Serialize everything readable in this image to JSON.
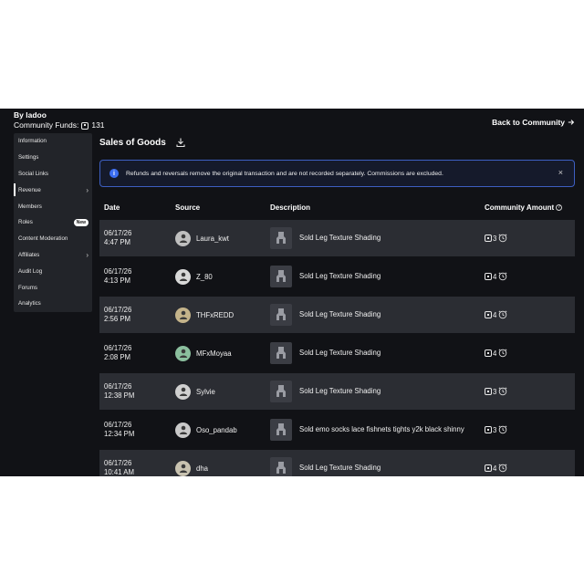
{
  "header": {
    "group_by": "By ladoo",
    "funds_label": "Community Funds:",
    "funds_value": "131",
    "back_label": "Back to Community"
  },
  "sidebar": {
    "items": [
      {
        "label": "Information"
      },
      {
        "label": "Settings"
      },
      {
        "label": "Social Links"
      },
      {
        "label": "Revenue"
      },
      {
        "label": "Members"
      },
      {
        "label": "Roles",
        "badge": "New"
      },
      {
        "label": "Content Moderation"
      },
      {
        "label": "Affiliates"
      },
      {
        "label": "Audit Log"
      },
      {
        "label": "Forums"
      },
      {
        "label": "Analytics"
      }
    ]
  },
  "main": {
    "title": "Sales of Goods",
    "info_text": "Refunds and reversals remove the original transaction and are not recorded separately. Commissions are excluded.",
    "columns": {
      "date": "Date",
      "source": "Source",
      "description": "Description",
      "amount": "Community Amount"
    },
    "rows": [
      {
        "date": "06/17/26",
        "time": "4:47 PM",
        "source": "Laura_kwt",
        "description": "Sold Leg Texture Shading",
        "amount": "3"
      },
      {
        "date": "06/17/26",
        "time": "4:13 PM",
        "source": "Z_80",
        "description": "Sold Leg Texture Shading",
        "amount": "4"
      },
      {
        "date": "06/17/26",
        "time": "2:56 PM",
        "source": "THFxREDD",
        "description": "Sold Leg Texture Shading",
        "amount": "4"
      },
      {
        "date": "06/17/26",
        "time": "2:08 PM",
        "source": "MFxMoyaa",
        "description": "Sold Leg Texture Shading",
        "amount": "4"
      },
      {
        "date": "06/17/26",
        "time": "12:38 PM",
        "source": "Sylvie",
        "description": "Sold Leg Texture Shading",
        "amount": "3"
      },
      {
        "date": "06/17/26",
        "time": "12:34 PM",
        "source": "Oso_pandab",
        "description": "Sold emo socks lace fishnets tights y2k black shinny",
        "amount": "3"
      },
      {
        "date": "06/17/26",
        "time": "10:41 AM",
        "source": "dha",
        "description": "Sold Leg Texture Shading",
        "amount": "4"
      }
    ]
  },
  "colors": {
    "background": "#111216",
    "row_alt": "#2b2d33",
    "sidebar": "#222429",
    "info_border": "#3d5fc2",
    "info_icon": "#3b6df0"
  },
  "icons": {
    "download": "download-icon",
    "info": "info-icon",
    "close": "close-icon",
    "back": "arrow-right-icon",
    "currency": "robux-icon",
    "pending": "clock-icon"
  }
}
